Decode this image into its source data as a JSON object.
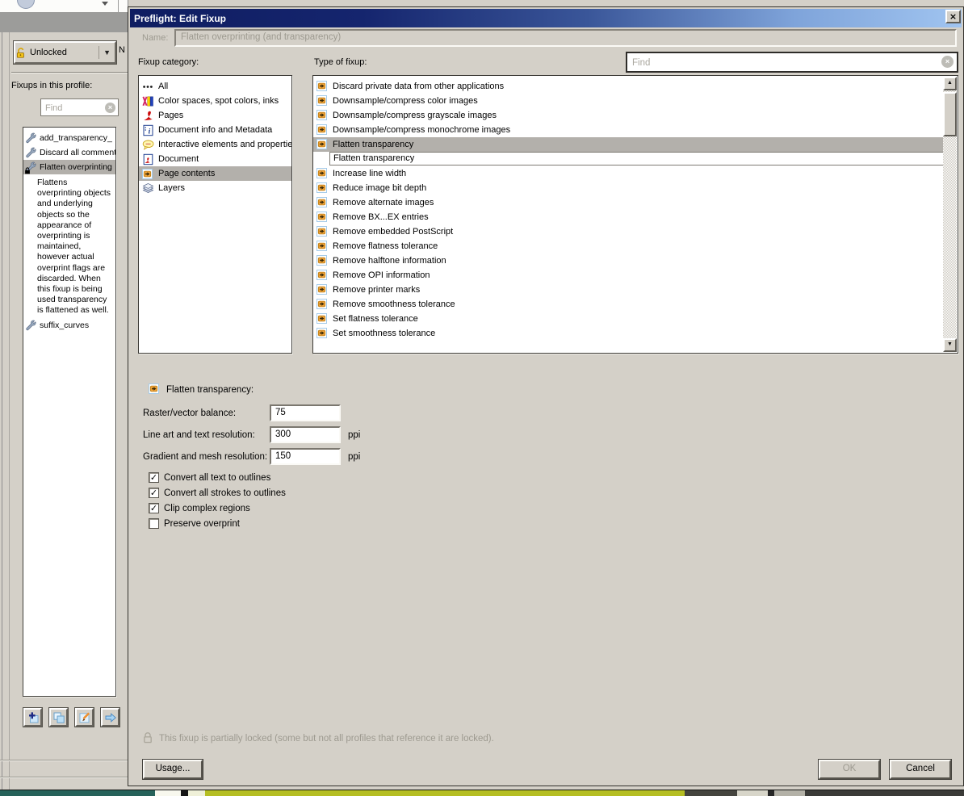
{
  "background_panel": {
    "lock_state_label": "Unlocked",
    "clipped_label": "N",
    "fixups_heading": "Fixups in this profile:",
    "find_placeholder": "Find",
    "fixups": [
      {
        "label": "add_transparency_"
      },
      {
        "label": "Discard all comment"
      },
      {
        "label": "Flatten overprinting"
      },
      {
        "label": "suffix_curves"
      }
    ],
    "selected_fixup": "Flatten overprinting",
    "selected_fixup_description": "Flattens overprinting objects and underlying objects so the appearance of overprinting is maintained, however actual overprint flags are discarded. When this fixup is being used transparency is flattened as well."
  },
  "dialog": {
    "title": "Preflight: Edit Fixup",
    "name_label": "Name:",
    "name_value": "Flatten overprinting (and transparency)",
    "fixup_category_label": "Fixup category:",
    "type_of_fixup_label": "Type of fixup:",
    "find_placeholder": "Find",
    "categories": [
      {
        "label": "All"
      },
      {
        "label": "Color spaces, spot colors, inks"
      },
      {
        "label": "Pages"
      },
      {
        "label": "Document info and Metadata"
      },
      {
        "label": "Interactive elements and propertie"
      },
      {
        "label": "Document"
      },
      {
        "label": "Page contents"
      },
      {
        "label": "Layers"
      }
    ],
    "selected_category": "Page contents",
    "fixup_types": [
      {
        "label": "Discard private data from other applications"
      },
      {
        "label": "Downsample/compress color images"
      },
      {
        "label": "Downsample/compress grayscale images"
      },
      {
        "label": "Downsample/compress monochrome images"
      },
      {
        "label": "Flatten transparency"
      },
      {
        "label": "Flatten transparency"
      },
      {
        "label": "Increase line width"
      },
      {
        "label": "Reduce image bit depth"
      },
      {
        "label": "Remove alternate images"
      },
      {
        "label": "Remove BX...EX entries"
      },
      {
        "label": "Remove embedded PostScript"
      },
      {
        "label": "Remove flatness tolerance"
      },
      {
        "label": "Remove halftone information"
      },
      {
        "label": "Remove OPI information"
      },
      {
        "label": "Remove printer marks"
      },
      {
        "label": "Remove smoothness tolerance"
      },
      {
        "label": "Set flatness tolerance"
      },
      {
        "label": "Set smoothness tolerance"
      }
    ],
    "selected_type": "Flatten transparency",
    "settings": {
      "heading": "Flatten transparency:",
      "fields": [
        {
          "label": "Raster/vector balance:",
          "value": "75",
          "unit": ""
        },
        {
          "label": "Line art and text resolution:",
          "value": "300",
          "unit": "ppi"
        },
        {
          "label": "Gradient and mesh resolution:",
          "value": "150",
          "unit": "ppi"
        }
      ],
      "checkboxes": [
        {
          "label": "Convert all text to outlines",
          "checked": true,
          "glyph": "✓"
        },
        {
          "label": "Convert all strokes to outlines",
          "checked": true,
          "glyph": "✓"
        },
        {
          "label": "Clip complex regions",
          "checked": true,
          "glyph": "✓"
        },
        {
          "label": "Preserve overprint",
          "checked": false,
          "glyph": ""
        }
      ]
    },
    "lock_note": "This fixup is partially locked (some but not all profiles that reference it are locked).",
    "buttons": {
      "usage": "Usage...",
      "ok": "OK",
      "cancel": "Cancel"
    },
    "ok_enabled": false
  },
  "icon_glyphs": {
    "up_arrow": "▲",
    "down_arrow": "▼",
    "dropdown": "▼",
    "close": "×"
  }
}
